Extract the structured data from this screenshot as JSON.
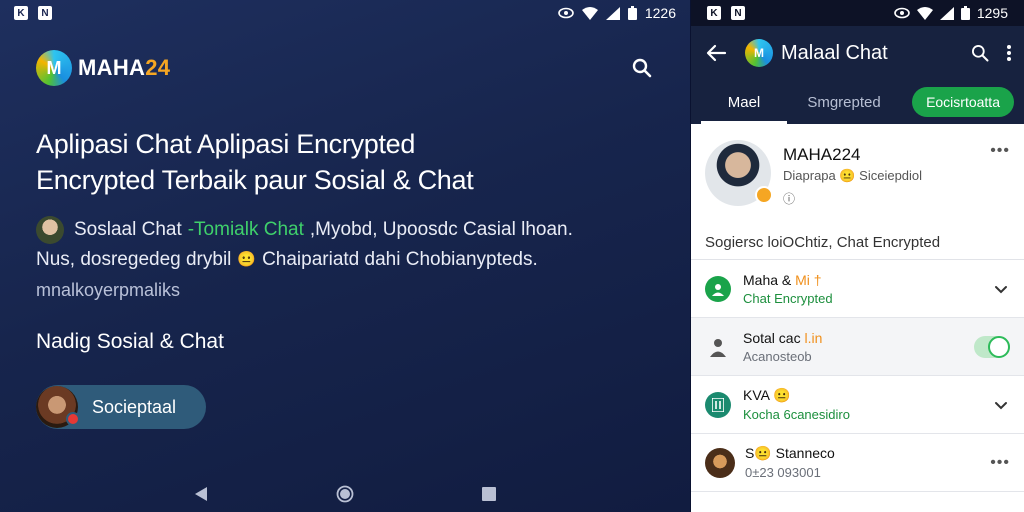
{
  "left": {
    "status": {
      "app1": "K",
      "app2": "N",
      "time": "1226"
    },
    "brand": {
      "main": "MAHA",
      "accent": "24",
      "logo_letter": "M"
    },
    "hero_lines": [
      "Aplipasi Chat Aplipasi Encrypted",
      "Encrypted Terbaik paur Sosial & Chat"
    ],
    "desc": {
      "line1_a": "Soslaal Chat",
      "line1_green": "-Tomialk Chat",
      "line1_b": ",Myobd, Upoosdc Casial lhoan.",
      "line2_a": "Nus, dosregedeg drybil",
      "line2_b": "Chaipariatd dahi Chobianypteds.",
      "line3": "mnalkoyerpmaliks"
    },
    "subheading": "Nadig Sosial & Chat",
    "pill_label": "Socieptaal",
    "icons": [
      "search-icon",
      "back-nav-icon",
      "home-nav-icon",
      "recents-nav-icon"
    ]
  },
  "right": {
    "status": {
      "app1": "K",
      "app2": "N",
      "time": "1295"
    },
    "appbar": {
      "title": "Malaal Chat",
      "logo_letter": "M"
    },
    "tabs": [
      "Mael",
      "Smgrepted",
      "Eocisrtoatta"
    ],
    "profile": {
      "name": "MAHA224",
      "line": "Diaprapa 😐 Siceiepdiol",
      "time": "ⓘ",
      "bio": "Sogiersc loiOChtiz, Chat Encrypted"
    },
    "items": [
      {
        "title": "Maha & ",
        "title_accent": "Mi †",
        "subtitle": "Chat Encrypted",
        "icon": "person-circle-icon"
      },
      {
        "title": "Sotal cac ",
        "title_accent": "l.in",
        "subtitle": "Acanosteob",
        "icon": "user-silhouette-icon"
      },
      {
        "title": "KVA 😐",
        "title_accent": "",
        "subtitle": "Kocha 6canesidiro",
        "icon": "building-icon"
      },
      {
        "title": "S😐 Stanneco",
        "title_accent": "",
        "subtitle": "0±23 093001",
        "icon": "avatar-face-icon"
      }
    ]
  },
  "colors": {
    "accent_green": "#1aa34a",
    "brand_orange": "#f5a623",
    "navy": "#17223f"
  }
}
